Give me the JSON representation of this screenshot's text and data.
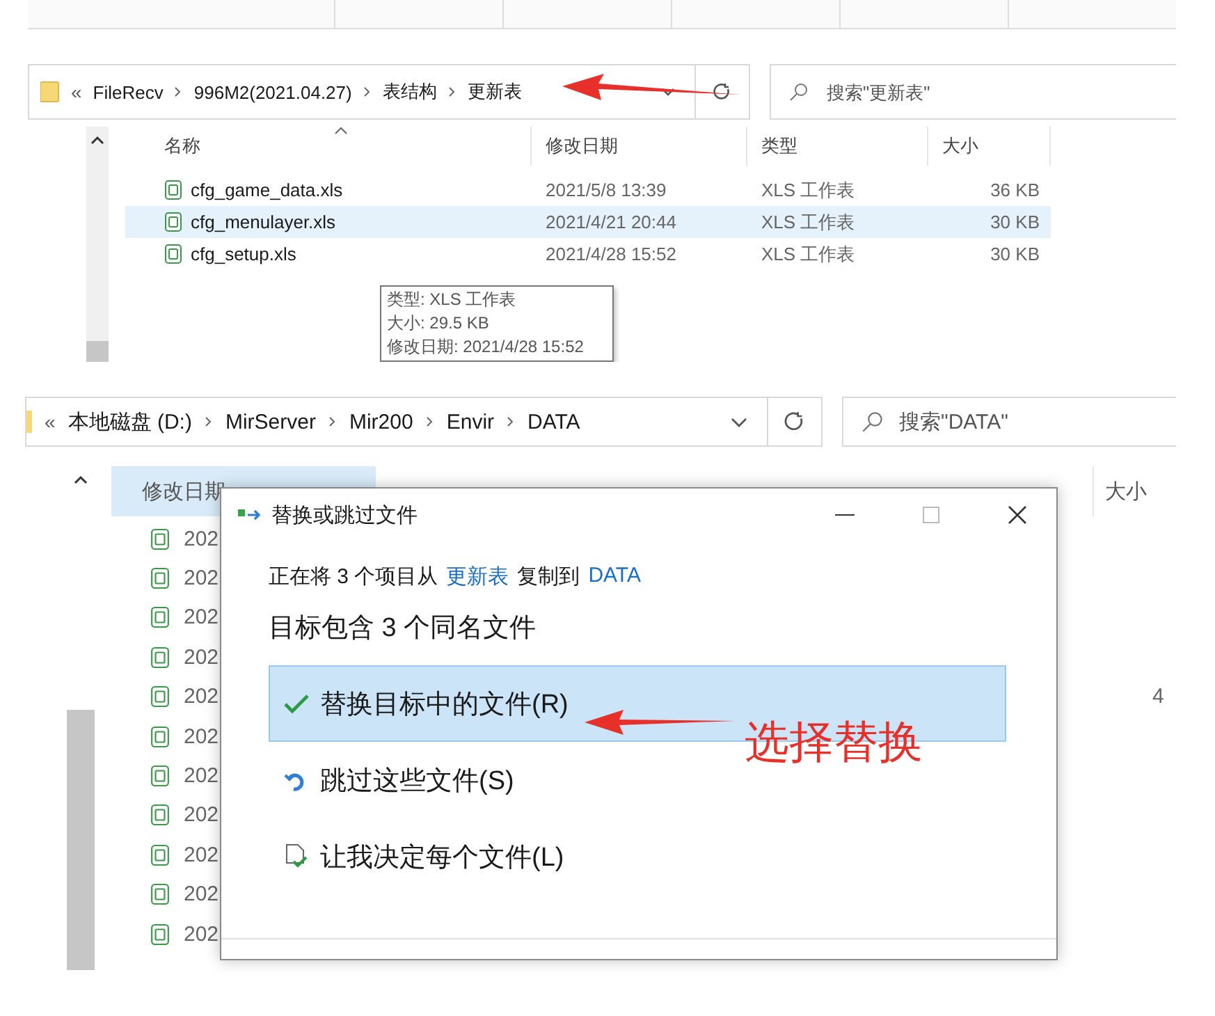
{
  "top_explorer": {
    "address_bar": {
      "overflow": "«",
      "crumbs": [
        "FileRecv",
        "996M2(2021.04.27)",
        "表结构",
        "更新表"
      ],
      "search_placeholder": "搜索\"更新表\""
    },
    "columns": [
      {
        "label": "名称",
        "sorted": true
      },
      {
        "label": "修改日期",
        "sorted": false
      },
      {
        "label": "类型",
        "sorted": false
      },
      {
        "label": "大小",
        "sorted": false
      }
    ],
    "rows": [
      {
        "name": "cfg_game_data.xls",
        "modified": "2021/5/8 13:39",
        "type": "XLS 工作表",
        "size": "36 KB",
        "selected": false
      },
      {
        "name": "cfg_menulayer.xls",
        "modified": "2021/4/21 20:44",
        "type": "XLS 工作表",
        "size": "30 KB",
        "selected": true
      },
      {
        "name": "cfg_setup.xls",
        "modified": "2021/4/28 15:52",
        "type": "XLS 工作表",
        "size": "30 KB",
        "selected": false
      }
    ],
    "tooltip": {
      "lines": [
        "类型: XLS 工作表",
        "大小: 29.5 KB",
        "修改日期: 2021/4/28 15:52"
      ]
    }
  },
  "bottom_explorer": {
    "address_bar": {
      "overflow": "«",
      "crumbs": [
        "本地磁盘 (D:)",
        "MirServer",
        "Mir200",
        "Envir",
        "DATA"
      ],
      "search_placeholder": "搜索\"DATA\""
    },
    "columns": [
      {
        "label": "修改日期",
        "selected": true
      },
      {
        "label": "大小",
        "selected": false
      }
    ],
    "rows": [
      {
        "modified": "202"
      },
      {
        "modified": "202"
      },
      {
        "modified": "202"
      },
      {
        "modified": "202"
      },
      {
        "modified": "202",
        "size": "4"
      },
      {
        "modified": "202"
      },
      {
        "modified": "202"
      },
      {
        "modified": "202"
      },
      {
        "modified": "202"
      },
      {
        "modified": "202"
      },
      {
        "modified": "202"
      }
    ]
  },
  "dialog": {
    "title": "替换或跳过文件",
    "message": [
      {
        "kind": "text",
        "text": "正在将 3 个项目从"
      },
      {
        "kind": "link",
        "text": "更新表"
      },
      {
        "kind": "text",
        "text": "复制到"
      },
      {
        "kind": "link",
        "text": "DATA"
      }
    ],
    "heading": "目标包含 3 个同名文件",
    "options": [
      {
        "kind": "replace",
        "label": "替换目标中的文件(R)",
        "selected": true
      },
      {
        "kind": "skip",
        "label": "跳过这些文件(S)",
        "selected": false
      },
      {
        "kind": "decide",
        "label": "让我决定每个文件(L)",
        "selected": false
      }
    ]
  },
  "annotation": {
    "label": "选择替换"
  }
}
